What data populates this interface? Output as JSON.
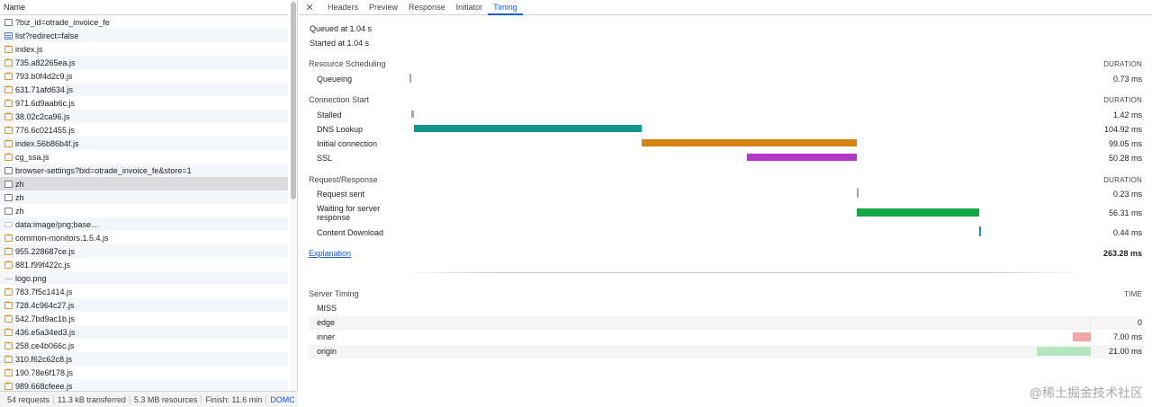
{
  "network": {
    "column_name": "Name",
    "requests": [
      {
        "name": "?biz_id=otrade_invoice_fe",
        "icon": "plain"
      },
      {
        "name": "list?redirect=false",
        "icon": "doc"
      },
      {
        "name": "index.js",
        "icon": "js"
      },
      {
        "name": "735.a82265ea.js",
        "icon": "js"
      },
      {
        "name": "793.b0f4d2c9.js",
        "icon": "js"
      },
      {
        "name": "631.71afd634.js",
        "icon": "js"
      },
      {
        "name": "971.6d9aab6c.js",
        "icon": "js"
      },
      {
        "name": "38.02c2ca96.js",
        "icon": "js"
      },
      {
        "name": "776.6c021455.js",
        "icon": "js"
      },
      {
        "name": "index.56b86b4f.js",
        "icon": "js"
      },
      {
        "name": "cg_ssa.js",
        "icon": "js"
      },
      {
        "name": "browser-settings?bid=otrade_invoice_fe&store=1",
        "icon": "plain"
      },
      {
        "name": "zh",
        "icon": "plain"
      },
      {
        "name": "zh",
        "icon": "plain"
      },
      {
        "name": "zh",
        "icon": "plain"
      },
      {
        "name": "data:image/png;base…",
        "icon": "img"
      },
      {
        "name": "common-monitors.1.5.4.js",
        "icon": "js"
      },
      {
        "name": "955.228687ce.js",
        "icon": "js"
      },
      {
        "name": "881.f99f422c.js",
        "icon": "js"
      },
      {
        "name": "logo.png",
        "icon": "dash"
      },
      {
        "name": "783.7f5c1414.js",
        "icon": "js"
      },
      {
        "name": "728.4c964c27.js",
        "icon": "js"
      },
      {
        "name": "542.7bd9ac1b.js",
        "icon": "js"
      },
      {
        "name": "436.e5a34ed3.js",
        "icon": "js"
      },
      {
        "name": "258.ce4b066c.js",
        "icon": "js"
      },
      {
        "name": "310.f62c62c8.js",
        "icon": "js"
      },
      {
        "name": "190.78e6f178.js",
        "icon": "js"
      },
      {
        "name": "989.668cfeee.js",
        "icon": "js"
      }
    ],
    "selected_index": 12,
    "status": {
      "requests": "54 requests",
      "transferred": "11.3 kB transferred",
      "resources": "5.3 MB resources",
      "finish": "Finish: 11.6 min",
      "dom": "DOMC"
    }
  },
  "tabs": [
    {
      "label": "Headers",
      "active": false
    },
    {
      "label": "Preview",
      "active": false
    },
    {
      "label": "Response",
      "active": false
    },
    {
      "label": "Initiator",
      "active": false
    },
    {
      "label": "Timing",
      "active": true
    }
  ],
  "timing": {
    "queued": "Queued at 1.04 s",
    "started": "Started at 1.04 s",
    "duration_header": "DURATION",
    "sections": {
      "scheduling": {
        "title": "Resource Scheduling",
        "rows": [
          {
            "label": "Queueing",
            "value": "0.73 ms",
            "ms": 0.73,
            "color": "#a8a8a8"
          }
        ]
      },
      "connection": {
        "title": "Connection Start",
        "rows": [
          {
            "label": "Stalled",
            "value": "1.42 ms",
            "ms": 1.42,
            "color": "#a8a8a8"
          },
          {
            "label": "DNS Lookup",
            "value": "104.92 ms",
            "ms": 104.92,
            "color": "#12968c"
          },
          {
            "label": "Initial connection",
            "value": "99.05 ms",
            "ms": 99.05,
            "color": "#d4830e"
          },
          {
            "label": "SSL",
            "value": "50.28 ms",
            "ms": 50.28,
            "color": "#b137c4"
          }
        ]
      },
      "request": {
        "title": "Request/Response",
        "rows": [
          {
            "label": "Request sent",
            "value": "0.23 ms",
            "ms": 0.23,
            "color": "#a8a8a8"
          },
          {
            "label": "Waiting for server response",
            "value": "56.31 ms",
            "ms": 56.31,
            "color": "#12a845"
          },
          {
            "label": "Content Download",
            "value": "0.44 ms",
            "ms": 0.44,
            "color": "#1a8fd6"
          }
        ]
      }
    },
    "explanation": "Explanation",
    "total": "263.28 ms"
  },
  "server_timing": {
    "title": "Server Timing",
    "time_header": "TIME",
    "rows": [
      {
        "label": "MISS",
        "value": "",
        "ms": 0,
        "color": ""
      },
      {
        "label": "edge",
        "value": "0",
        "ms": 0,
        "color": "#c9e8d6"
      },
      {
        "label": "inner",
        "value": "7.00 ms",
        "ms": 7.0,
        "color": "#f2a6a6"
      },
      {
        "label": "origin",
        "value": "21.00 ms",
        "ms": 21.0,
        "color": "#b4e6c2"
      }
    ]
  },
  "watermark": "@稀土掘金技术社区"
}
